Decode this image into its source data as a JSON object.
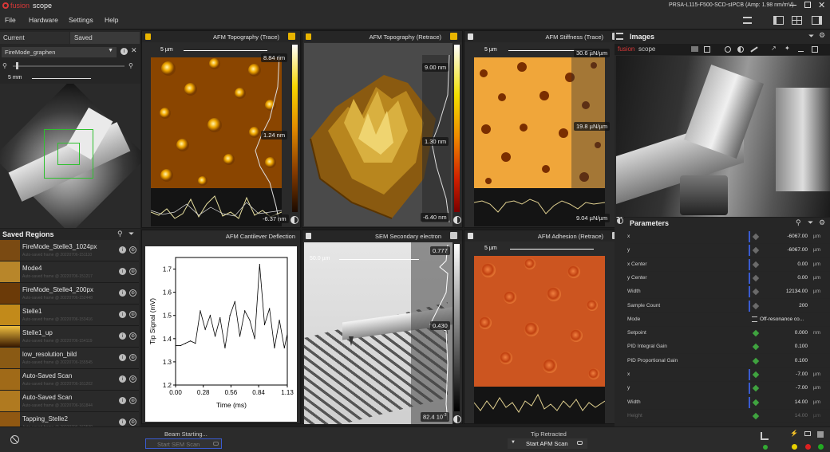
{
  "app": {
    "logo_prefix": "fusion",
    "logo_suffix": "scope",
    "window_title": "PRSA-L115-F500-SCD-sIPCB (Amp: 1.98 nm/mV)"
  },
  "menu": [
    "File",
    "Hardware",
    "Settings",
    "Help"
  ],
  "left": {
    "tab_current": "Current",
    "tab_saved": "Saved",
    "dataset": "FireMode_graphen",
    "scale": "5 mm"
  },
  "saved_regions": {
    "title": "Saved Regions",
    "items": [
      {
        "name": "FireMode_Stelle3_1024px",
        "sub": "Auto-saved frame @ 20220706-151110"
      },
      {
        "name": "Mode4",
        "sub": "Auto-saved frame @ 20220706-151217"
      },
      {
        "name": "FireMode_Stelle4_200px",
        "sub": "Auto-saved frame @ 20220706-152448"
      },
      {
        "name": "Stelle1",
        "sub": "Auto-saved frame @ 20220706-153416"
      },
      {
        "name": "Stelle1_up",
        "sub": "Auto-saved frame @ 20220706-154119"
      },
      {
        "name": "low_resolution_bild",
        "sub": "Auto-saved frame @ 20220706-155545"
      },
      {
        "name": "Auto-Saved Scan",
        "sub": "Auto-saved frame @ 20220706-161202"
      },
      {
        "name": "Auto-Saved Scan",
        "sub": "Auto-saved frame @ 20220706-161844"
      },
      {
        "name": "Tapping_Stelle2",
        "sub": "Auto-saved frame @ 20220706-162530"
      }
    ]
  },
  "panels": {
    "afm_trace": {
      "title": "AFM Topography (Trace)",
      "scale": "5 µm",
      "max": "8.84 nm",
      "mid": "1.24 nm",
      "min": "-6.37 nm"
    },
    "afm_retrace": {
      "title": "AFM Topography (Retrace)",
      "max": "9.00 nm",
      "mid": "1.30 nm",
      "min": "-6.40 nm"
    },
    "afm_stiffness": {
      "title": "AFM Stiffness (Trace)",
      "scale": "5 µm",
      "max": "30.6 µN/µm",
      "mid": "19.8 µN/µm",
      "min": "9.04 µN/µm"
    },
    "cantilever": {
      "title": "AFM Cantilever Deflection"
    },
    "sem": {
      "title": "SEM Secondary electron",
      "scale": "50.0 µm",
      "max": "0.777",
      "mid": "0.430",
      "min": "82.4",
      "min_exp": "10",
      "min_exp_sup": "-3"
    },
    "afm_adhesion": {
      "title": "AFM Adhesion  (Retrace)",
      "scale": "5 µm"
    }
  },
  "chart_data": {
    "type": "line",
    "title": "",
    "xlabel": "Time (ms)",
    "ylabel": "Tip Signal (mV)",
    "xlim": [
      0,
      1.13
    ],
    "ylim": [
      1.2,
      1.75
    ],
    "x_ticks": [
      "0.00",
      "0.28",
      "0.56",
      "0.84",
      "1.13"
    ],
    "y_ticks": [
      "1.2",
      "1.3",
      "1.4",
      "1.5",
      "1.6",
      "1.7"
    ],
    "series": [
      {
        "x": [
          0.0,
          0.05,
          0.1,
          0.15,
          0.2,
          0.25,
          0.3,
          0.35,
          0.4,
          0.45,
          0.5,
          0.55,
          0.6,
          0.65,
          0.7,
          0.75,
          0.8,
          0.85,
          0.9,
          0.95,
          1.0,
          1.05,
          1.1,
          1.13
        ],
        "values": [
          1.37,
          1.37,
          1.38,
          1.39,
          1.38,
          1.52,
          1.44,
          1.5,
          1.41,
          1.49,
          1.36,
          1.5,
          1.56,
          1.41,
          1.52,
          1.48,
          1.4,
          1.72,
          1.46,
          1.53,
          1.36,
          1.48,
          1.36,
          1.42
        ]
      }
    ]
  },
  "images": {
    "title": "Images"
  },
  "parameters": {
    "title": "Parameters",
    "rows": [
      {
        "name": "x",
        "value": "-6067.00",
        "unit": "µm",
        "mark": true
      },
      {
        "name": "y",
        "value": "-6067.00",
        "unit": "µm",
        "mark": true
      },
      {
        "name": "x Center",
        "value": "0.00",
        "unit": "µm",
        "mark": true
      },
      {
        "name": "y Center",
        "value": "0.00",
        "unit": "µm",
        "mark": true
      },
      {
        "name": "Width",
        "value": "12134.00",
        "unit": "µm",
        "mark": true
      },
      {
        "name": "Sample Count",
        "value": "200",
        "unit": "",
        "mark": true
      },
      {
        "name": "Mode",
        "value": "Off-resonance co...",
        "unit": "",
        "mark": false
      },
      {
        "name": "Setpoint",
        "value": "0.000",
        "unit": "nm",
        "mark": false
      },
      {
        "name": "PID Integral Gain",
        "value": "0.100",
        "unit": "",
        "mark": false
      },
      {
        "name": "PID Proportional Gain",
        "value": "0.100",
        "unit": "",
        "mark": false
      },
      {
        "name": "x",
        "value": "-7.00",
        "unit": "µm",
        "mark": true
      },
      {
        "name": "y",
        "value": "-7.00",
        "unit": "µm",
        "mark": true
      },
      {
        "name": "Width",
        "value": "14.00",
        "unit": "µm",
        "mark": true
      },
      {
        "name": "Height",
        "value": "14.00",
        "unit": "µm",
        "mark": false
      }
    ]
  },
  "bottom": {
    "beam_status": "Beam Starting...",
    "sem_button": "Start SEM Scan",
    "tip_status": "Tip Retracted",
    "afm_button": "Start AFM Scan"
  }
}
